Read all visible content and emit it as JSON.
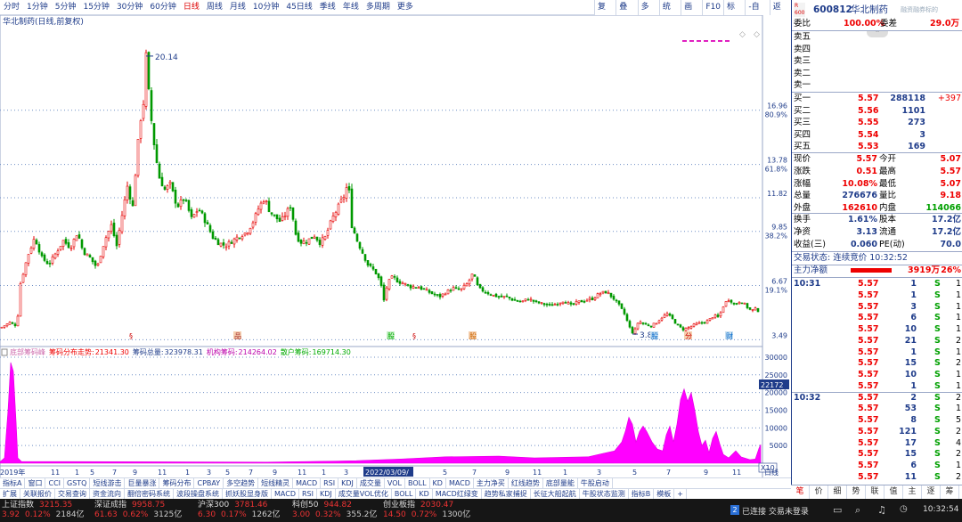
{
  "period_bar": {
    "items": [
      "分时",
      "1分钟",
      "5分钟",
      "15分钟",
      "30分钟",
      "60分钟",
      "日线",
      "周线",
      "月线",
      "10分钟",
      "45日线",
      "季线",
      "年线",
      "多周期",
      "更多"
    ],
    "active": 6
  },
  "top_tools": [
    "复权",
    "叠加",
    "多股",
    "统计",
    "画线",
    "F10",
    "标记",
    "-自选",
    "返回"
  ],
  "chart": {
    "stock_label": "华北制药(日线,前复权)",
    "price_ticks": [
      {
        "price": 16.96,
        "pct": "80.9%",
        "price_label": "16.96"
      },
      {
        "price": 13.78,
        "pct": "61.8%",
        "price_label": "13.78"
      },
      {
        "price": 11.82,
        "pct": "",
        "price_label": "11.82"
      },
      {
        "price": 9.85,
        "pct": "38.2%",
        "price_label": "9.85"
      },
      {
        "price": 6.67,
        "pct": "19.1%",
        "price_label": "6.67"
      },
      {
        "price": 3.49,
        "pct": "",
        "price_label": "3.49"
      }
    ],
    "high_marker": "20.14",
    "low_marker": "3.82",
    "chip_title": "底部筹码峰",
    "chip_stats": [
      {
        "label": "筹码分布走势:",
        "value": "21341.30",
        "color": "#e00"
      },
      {
        "label": "筹码总量:",
        "value": "323978.31",
        "color": "#1f3c8a"
      },
      {
        "label": "机构筹码:",
        "value": "214264.02",
        "color": "#b0a"
      },
      {
        "label": "散户筹码:",
        "value": "169714.30",
        "color": "#0a0"
      }
    ],
    "chip_axis": [
      "30000",
      "25000",
      "20000",
      "15000",
      "10000",
      "5000"
    ],
    "chip_cursor": "22172",
    "x10": "X10",
    "date_labels": [
      "2019年",
      "11",
      "1",
      "5",
      "7",
      "9",
      "11",
      "1",
      "3",
      "5",
      "7",
      "9",
      "11",
      "1",
      "3",
      "5",
      "7",
      "9",
      "11",
      "1",
      "3",
      "5",
      "7",
      "9",
      "11"
    ],
    "date_cursor": "2022/03/09/",
    "right_mini": "日线"
  },
  "chart_data": {
    "type": "candlestick",
    "price_range": [
      3.3,
      21.6
    ],
    "chip_range": [
      0,
      32000
    ],
    "candles_approx": "generated",
    "ohlc_path": [
      [
        0,
        4.2
      ],
      [
        10,
        4.5
      ],
      [
        18,
        4.3
      ],
      [
        22,
        6.8
      ],
      [
        30,
        8.4
      ],
      [
        38,
        9.5
      ],
      [
        46,
        8.3
      ],
      [
        54,
        7.9
      ],
      [
        62,
        8.6
      ],
      [
        70,
        9.3
      ],
      [
        78,
        8.9
      ],
      [
        86,
        9.8
      ],
      [
        92,
        8.7
      ],
      [
        100,
        8.3
      ],
      [
        108,
        7.7
      ],
      [
        114,
        8.9
      ],
      [
        118,
        9.5
      ],
      [
        124,
        10.2
      ],
      [
        130,
        9.0
      ],
      [
        136,
        10.8
      ],
      [
        142,
        12.5
      ],
      [
        148,
        11.3
      ],
      [
        152,
        13.9
      ],
      [
        156,
        16.2
      ],
      [
        160,
        17.4
      ],
      [
        163,
        20.14
      ],
      [
        166,
        18.0
      ],
      [
        170,
        15.8
      ],
      [
        174,
        14.2
      ],
      [
        178,
        13.0
      ],
      [
        184,
        12.3
      ],
      [
        190,
        12.6
      ],
      [
        198,
        11.3
      ],
      [
        206,
        11.8
      ],
      [
        214,
        10.6
      ],
      [
        222,
        11.2
      ],
      [
        230,
        10.4
      ],
      [
        238,
        9.5
      ],
      [
        244,
        9.2
      ],
      [
        252,
        9.0
      ],
      [
        260,
        9.3
      ],
      [
        268,
        9.6
      ],
      [
        276,
        9.8
      ],
      [
        284,
        10.5
      ],
      [
        290,
        11.3
      ],
      [
        296,
        11.8
      ],
      [
        302,
        11.0
      ],
      [
        308,
        10.7
      ],
      [
        314,
        10.4
      ],
      [
        320,
        10.9
      ],
      [
        326,
        11.4
      ],
      [
        330,
        9.8
      ],
      [
        336,
        9.2
      ],
      [
        344,
        9.3
      ],
      [
        352,
        9.6
      ],
      [
        358,
        9.2
      ],
      [
        364,
        9.5
      ],
      [
        372,
        10.6
      ],
      [
        380,
        11.4
      ],
      [
        386,
        12.0
      ],
      [
        390,
        12.8
      ],
      [
        394,
        10.2
      ],
      [
        400,
        9.3
      ],
      [
        406,
        8.6
      ],
      [
        412,
        7.9
      ],
      [
        420,
        7.5
      ],
      [
        426,
        6.9
      ],
      [
        430,
        5.8
      ],
      [
        434,
        6.8
      ],
      [
        440,
        7.2
      ],
      [
        446,
        6.9
      ],
      [
        452,
        6.8
      ],
      [
        460,
        6.6
      ],
      [
        468,
        6.6
      ],
      [
        476,
        6.4
      ],
      [
        484,
        6.2
      ],
      [
        492,
        6.0
      ],
      [
        500,
        6.3
      ],
      [
        508,
        6.5
      ],
      [
        516,
        6.4
      ],
      [
        524,
        6.8
      ],
      [
        530,
        7.4
      ],
      [
        536,
        6.5
      ],
      [
        544,
        6.3
      ],
      [
        552,
        6.1
      ],
      [
        560,
        6.0
      ],
      [
        568,
        6.0
      ],
      [
        576,
        5.8
      ],
      [
        584,
        5.7
      ],
      [
        592,
        5.9
      ],
      [
        600,
        5.7
      ],
      [
        608,
        5.6
      ],
      [
        616,
        5.5
      ],
      [
        624,
        5.6
      ],
      [
        632,
        5.8
      ],
      [
        640,
        5.5
      ],
      [
        648,
        5.7
      ],
      [
        656,
        5.8
      ],
      [
        664,
        5.9
      ],
      [
        672,
        6.2
      ],
      [
        680,
        6.3
      ],
      [
        688,
        5.9
      ],
      [
        694,
        5.5
      ],
      [
        700,
        5.0
      ],
      [
        706,
        4.2
      ],
      [
        710,
        3.82
      ],
      [
        716,
        4.6
      ],
      [
        722,
        4.4
      ],
      [
        730,
        4.3
      ],
      [
        736,
        4.5
      ],
      [
        742,
        4.8
      ],
      [
        748,
        5.0
      ],
      [
        754,
        4.7
      ],
      [
        760,
        4.3
      ],
      [
        766,
        4.1
      ],
      [
        772,
        4.2
      ],
      [
        780,
        4.4
      ],
      [
        788,
        4.5
      ],
      [
        794,
        4.6
      ],
      [
        800,
        4.9
      ],
      [
        806,
        4.8
      ],
      [
        812,
        5.6
      ],
      [
        818,
        5.9
      ],
      [
        824,
        5.5
      ],
      [
        830,
        5.8
      ],
      [
        836,
        5.5
      ],
      [
        842,
        5.2
      ],
      [
        848,
        5.3
      ],
      [
        852,
        5.1
      ]
    ],
    "chip_path": [
      [
        0,
        400
      ],
      [
        5,
        1500
      ],
      [
        9,
        15000
      ],
      [
        12,
        28500
      ],
      [
        15,
        26000
      ],
      [
        18,
        12000
      ],
      [
        20,
        1500
      ],
      [
        24,
        500
      ],
      [
        300,
        300
      ],
      [
        400,
        700
      ],
      [
        450,
        1200
      ],
      [
        500,
        1800
      ],
      [
        560,
        2000
      ],
      [
        600,
        1500
      ],
      [
        660,
        1800
      ],
      [
        690,
        3500
      ],
      [
        698,
        6000
      ],
      [
        702,
        9000
      ],
      [
        706,
        13000
      ],
      [
        710,
        11000
      ],
      [
        714,
        6000
      ],
      [
        718,
        9000
      ],
      [
        722,
        10500
      ],
      [
        726,
        9000
      ],
      [
        732,
        6000
      ],
      [
        738,
        4000
      ],
      [
        744,
        3500
      ],
      [
        748,
        8000
      ],
      [
        752,
        10500
      ],
      [
        756,
        6000
      ],
      [
        760,
        11000
      ],
      [
        764,
        18000
      ],
      [
        768,
        21000
      ],
      [
        772,
        17500
      ],
      [
        776,
        20000
      ],
      [
        780,
        15000
      ],
      [
        784,
        9000
      ],
      [
        788,
        5000
      ],
      [
        792,
        6500
      ],
      [
        796,
        3000
      ],
      [
        800,
        7000
      ],
      [
        804,
        9000
      ],
      [
        808,
        5500
      ],
      [
        812,
        2500
      ],
      [
        818,
        1500
      ],
      [
        826,
        3500
      ],
      [
        832,
        1800
      ],
      [
        842,
        1000
      ],
      [
        848,
        1200
      ],
      [
        852,
        4200
      ],
      [
        854,
        5300
      ]
    ]
  },
  "right": {
    "code": "600812",
    "name": "华北制药",
    "sub": "融资融券标的",
    "weibi_label": "委比",
    "weibi": "100.00%",
    "weicha_label": "委差",
    "weicha": "29.0万",
    "sell_labels": [
      "卖五",
      "卖四",
      "卖三",
      "卖二",
      "卖一"
    ],
    "buys": [
      {
        "label": "买一",
        "price": "5.57",
        "vol": "288118",
        "chg": "+397"
      },
      {
        "label": "买二",
        "price": "5.56",
        "vol": "1101",
        "chg": ""
      },
      {
        "label": "买三",
        "price": "5.55",
        "vol": "273",
        "chg": ""
      },
      {
        "label": "买四",
        "price": "5.54",
        "vol": "3",
        "chg": ""
      },
      {
        "label": "买五",
        "price": "5.53",
        "vol": "169",
        "chg": ""
      }
    ],
    "quotes": [
      {
        "l1": "现价",
        "v1": "5.57",
        "c1": "red",
        "l2": "今开",
        "v2": "5.07",
        "c2": "red"
      },
      {
        "l1": "涨跌",
        "v1": "0.51",
        "c1": "red",
        "l2": "最高",
        "v2": "5.57",
        "c2": "red"
      },
      {
        "l1": "涨幅",
        "v1": "10.08%",
        "c1": "red",
        "l2": "最低",
        "v2": "5.07",
        "c2": "red"
      },
      {
        "l1": "总量",
        "v1": "276676",
        "c1": "blu",
        "l2": "量比",
        "v2": "9.18",
        "c2": "red"
      },
      {
        "l1": "外盘",
        "v1": "162610",
        "c1": "red",
        "l2": "内盘",
        "v2": "114066",
        "c2": "grn"
      },
      {
        "l1": "换手",
        "v1": "1.61%",
        "c1": "blu",
        "l2": "股本",
        "v2": "17.2亿",
        "c2": "blu"
      },
      {
        "l1": "净资",
        "v1": "3.13",
        "c1": "blu",
        "l2": "流通",
        "v2": "17.2亿",
        "c2": "blu"
      },
      {
        "l1": "收益(三)",
        "v1": "0.060",
        "c1": "blu",
        "l2": "PE(动)",
        "v2": "70.0",
        "c2": "blu"
      }
    ],
    "trade_status": "交易状态: 连续竞价 10:32:52",
    "main_net_label": "主力净额",
    "main_net_value": "3919万",
    "main_net_pct": "26%",
    "ticks": [
      {
        "time": "10:31",
        "price": "5.57",
        "vol": "1",
        "side": "S",
        "n": "1"
      },
      {
        "time": "",
        "price": "5.57",
        "vol": "1",
        "side": "S",
        "n": "1"
      },
      {
        "time": "",
        "price": "5.57",
        "vol": "3",
        "side": "S",
        "n": "1"
      },
      {
        "time": "",
        "price": "5.57",
        "vol": "6",
        "side": "S",
        "n": "1"
      },
      {
        "time": "",
        "price": "5.57",
        "vol": "10",
        "side": "S",
        "n": "1"
      },
      {
        "time": "",
        "price": "5.57",
        "vol": "21",
        "side": "S",
        "n": "2"
      },
      {
        "time": "",
        "price": "5.57",
        "vol": "1",
        "side": "S",
        "n": "1"
      },
      {
        "time": "",
        "price": "5.57",
        "vol": "15",
        "side": "S",
        "n": "2"
      },
      {
        "time": "",
        "price": "5.57",
        "vol": "10",
        "side": "S",
        "n": "1"
      },
      {
        "time": "",
        "price": "5.57",
        "vol": "1",
        "side": "S",
        "n": "1"
      },
      {
        "time": "10:32",
        "price": "5.57",
        "vol": "2",
        "side": "S",
        "n": "2"
      },
      {
        "time": "",
        "price": "5.57",
        "vol": "53",
        "side": "S",
        "n": "1"
      },
      {
        "time": "",
        "price": "5.57",
        "vol": "8",
        "side": "S",
        "n": "5"
      },
      {
        "time": "",
        "price": "5.57",
        "vol": "121",
        "side": "S",
        "n": "2"
      },
      {
        "time": "",
        "price": "5.57",
        "vol": "17",
        "side": "S",
        "n": "4"
      },
      {
        "time": "",
        "price": "5.57",
        "vol": "15",
        "side": "S",
        "n": "2"
      },
      {
        "time": "",
        "price": "5.57",
        "vol": "6",
        "side": "S",
        "n": "1"
      },
      {
        "time": "",
        "price": "5.57",
        "vol": "11",
        "side": "S",
        "n": "2"
      }
    ],
    "tabs": [
      "笔",
      "价",
      "细",
      "势",
      "联",
      "值",
      "主",
      "逐",
      "筹"
    ],
    "active_tab": 0
  },
  "bottom_tabs1": [
    "指标A",
    "窗口",
    "CCI",
    "GSTQ",
    "短线游击",
    "巨量暴涨",
    "筹码分布",
    "CPBAY",
    "多空趋势",
    "短线精灵",
    "MACD",
    "RSI",
    "KDJ",
    "成交量",
    "VOL",
    "BOLL",
    "KD",
    "MACD",
    "主力净买",
    "红线趋势",
    "底部量能",
    "牛股启动"
  ],
  "bottom_tabs2": [
    "扩展",
    "关联报价",
    "交易查询",
    "资金流向",
    "翻倍密码系统",
    "波段操盘系统",
    "抓妖股显身版",
    "MACD",
    "RSI",
    "KDJ",
    "成交量VOL优化",
    "BOLL",
    "KD",
    "MACD红绿变",
    "趋势私家捕捉",
    "长征大船起航",
    "牛股状态监测",
    "指标B",
    "模板",
    "+"
  ],
  "statusbar": {
    "indices": [
      {
        "name": "上证指数",
        "value": "3215.35",
        "chg": "3.92",
        "pct": "0.12%",
        "amt": "2184亿"
      },
      {
        "name": "深证成指",
        "value": "9958.75",
        "chg": "61.63",
        "pct": "0.62%",
        "amt": "3125亿"
      },
      {
        "name": "沪深300",
        "value": "3781.46",
        "chg": "6.30",
        "pct": "0.17%",
        "amt": "1262亿"
      },
      {
        "name": "科创50",
        "value": "944.82",
        "chg": "3.00",
        "pct": "0.32%",
        "amt": "355.2亿"
      },
      {
        "name": "创业板指",
        "value": "2030.47",
        "chg": "14.50",
        "pct": "0.72%",
        "amt": "1300亿"
      }
    ],
    "connection": "已连接 交易未登录",
    "clock": "10:32:54",
    "badge": "2"
  }
}
